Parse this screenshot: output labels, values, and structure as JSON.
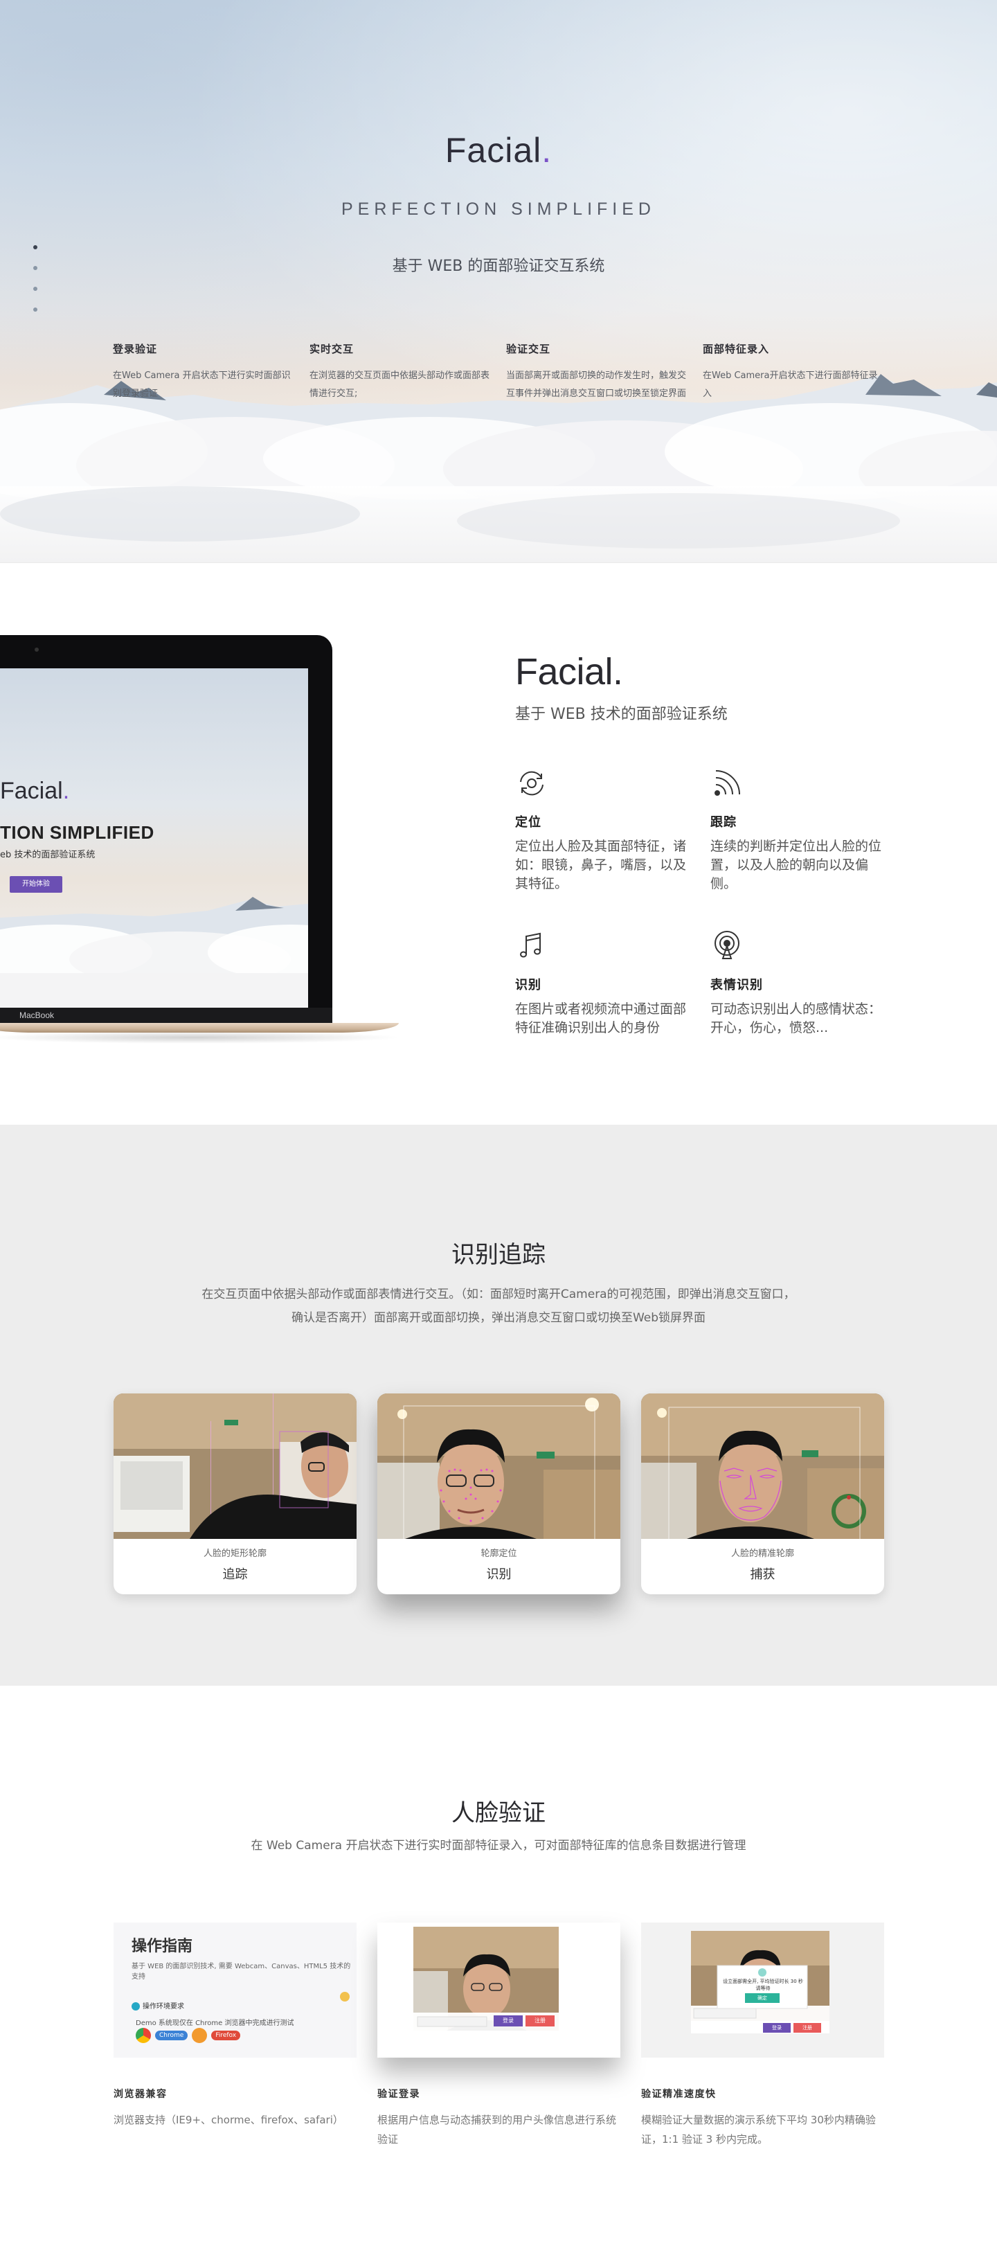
{
  "hero": {
    "logo_text": "Facial",
    "logo_dot": ".",
    "tagline": "PERFECTION SIMPLIFIED",
    "subtitle": "基于 WEB 的面部验证交互系统",
    "features": [
      {
        "title": "登录验证",
        "desc": "在Web Camera 开启状态下进行实时面部识别登录验证"
      },
      {
        "title": "实时交互",
        "desc": "在浏览器的交互页面中依据头部动作或面部表情进行交互;"
      },
      {
        "title": "验证交互",
        "desc": "当面部离开或面部切换的动作发生时，触发交互事件并弹出消息交互窗口或切换至锁定界面"
      },
      {
        "title": "面部特征录入",
        "desc": "在Web Camera开启状态下进行面部特征录入"
      }
    ]
  },
  "intro": {
    "laptop": {
      "logo_text": "Facial",
      "logo_dot": ".",
      "tagline": "TION SIMPLIFIED",
      "subtitle": "eb 技术的面部验证系统",
      "button": "开始体验",
      "brand": "MacBook"
    },
    "title": "Facial.",
    "subtitle": "基于 WEB 技术的面部验证系统",
    "features": [
      {
        "icon": "locate-rotate-icon",
        "title": "定位",
        "desc": "定位出人脸及其面部特征，诸如：眼镜，鼻子，嘴唇，以及其特征。"
      },
      {
        "icon": "signal-track-icon",
        "title": "跟踪",
        "desc": "连续的判断并定位出人脸的位置，以及人脸的朝向以及偏侧。"
      },
      {
        "icon": "music-note-icon",
        "title": "识别",
        "desc": "在图片或者视频流中通过面部特征准确识别出人的身份"
      },
      {
        "icon": "broadcast-icon",
        "title": "表情识别",
        "desc": "可动态识别出人的感情状态：开心，伤心，愤怒..."
      }
    ]
  },
  "tracking": {
    "title": "识别追踪",
    "desc_line1": "在交互页面中依据头部动作或面部表情进行交互。（如：面部短时离开Camera的可视范围，即弹出消息交互窗口，",
    "desc_line2": "确认是否离开）面部离开或面部切换，弹出消息交互窗口或切换至Web锁屏界面",
    "cards": [
      {
        "small": "人脸的矩形轮廓",
        "big": "追踪"
      },
      {
        "small": "轮廓定位",
        "big": "识别"
      },
      {
        "small": "人脸的精准轮廓",
        "big": "捕获"
      }
    ]
  },
  "verify": {
    "title": "人脸验证",
    "desc": "在 Web Camera 开启状态下进行实时面部特征录入，可对面部特征库的信息条目数据进行管理",
    "guide": {
      "title": "操作指南",
      "sub": "基于 WEB 的面部识别技术, 需要 Webcam、Canvas、HTML5 技术的支持",
      "row1": "操作环境要求",
      "row2": "Demo 系统现仅在 Chrome 浏览器中完成进行测试",
      "browsers": [
        "Chrome",
        "Firefox"
      ]
    },
    "items": [
      {
        "title": "浏览器兼容",
        "desc": "浏览器支持（IE9+、chorme、firefox、safari）"
      },
      {
        "title": "验证登录",
        "desc": "根据用户信息与动态捕获到的用户头像信息进行系统验证"
      },
      {
        "title": "验证精准速度快",
        "desc": "模糊验证大量数据的演示系统下平均 30秒内精确验证，1:1 验证 3 秒内完成。"
      }
    ],
    "modal_buttons": [
      "登录",
      "注册"
    ],
    "popup_text": "设立面部需全开, 平均验证时长 30 秒 请等待",
    "popup_btn": "确定"
  },
  "colors": {
    "accent": "#7a52c7",
    "button_purple": "#6b4fb3",
    "button_red": "#e85a5a",
    "section_grey": "#ededed"
  }
}
